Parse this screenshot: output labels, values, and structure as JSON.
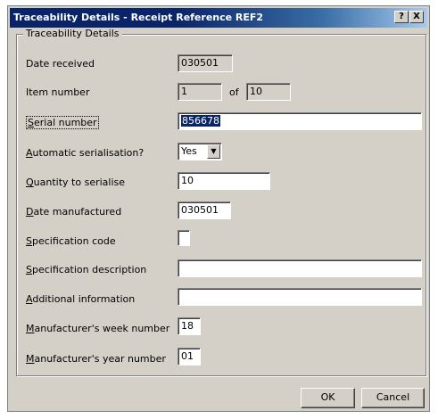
{
  "window": {
    "title": "Traceability Details - Receipt Reference REF2",
    "help_glyph": "?",
    "close_glyph": "X"
  },
  "group": {
    "label": "Traceability Details"
  },
  "fields": {
    "date_received": {
      "label": "Date received",
      "value": "030501"
    },
    "item_number": {
      "label": "Item number",
      "value": "1",
      "of_text": "of",
      "total": "10"
    },
    "serial_number": {
      "label_first": "S",
      "label_rest": "erial number",
      "value": "856678"
    },
    "automatic_serialisation": {
      "label_first": "A",
      "label_rest": "utomatic serialisation?",
      "value": "Yes"
    },
    "quantity_to_serialise": {
      "label_first": "Q",
      "label_rest": "uantity to serialise",
      "value": "10"
    },
    "date_manufactured": {
      "label_first": "D",
      "label_rest": "ate manufactured",
      "value": "030501"
    },
    "specification_code": {
      "label_first": "S",
      "label_rest": "pecification code"
    },
    "specification_description": {
      "label_first": "S",
      "label_rest": "pecification description",
      "value": ""
    },
    "additional_information": {
      "label_first": "A",
      "label_rest": "dditional information",
      "value": ""
    },
    "manufacturers_week_number": {
      "label_first": "M",
      "label_rest": "anufacturer's week number",
      "value": "18"
    },
    "manufacturers_year_number": {
      "label_first": "M",
      "label_rest": "anufacturer's year number",
      "value": "01"
    }
  },
  "buttons": {
    "ok": "OK",
    "cancel": "Cancel"
  },
  "icons": {
    "combo_arrow": "chevron-down-icon"
  },
  "colors": {
    "title_bar": "#0a246a",
    "face": "#d4d0c8",
    "selection": "#0a246a"
  }
}
